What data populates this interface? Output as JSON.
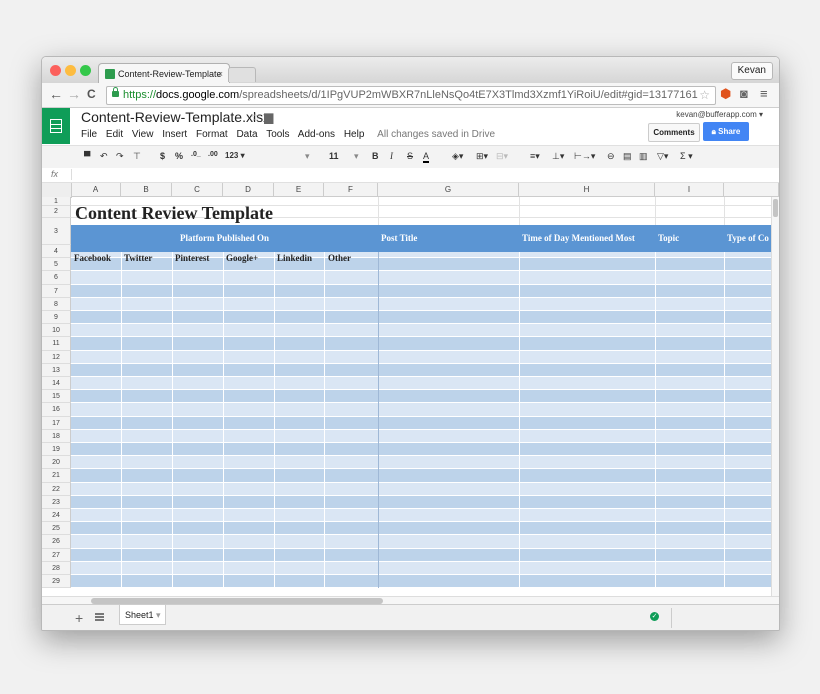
{
  "browser": {
    "tab_title": "Content-Review-Template",
    "tab_close": "×",
    "user": "Kevan",
    "url_scheme": "https://",
    "url_host": "docs.google.com",
    "url_path": "/spreadsheets/d/1IPgVUP2mWBXR7nLleNsQo4tE7X3Tlmd3Xzmf1YiRoiU/edit#gid=13177161",
    "back": "←",
    "forward": "→",
    "reload": "C"
  },
  "doc": {
    "title": "Content-Review-Template.xlsx",
    "menus": [
      "File",
      "Edit",
      "View",
      "Insert",
      "Format",
      "Data",
      "Tools",
      "Add-ons",
      "Help"
    ],
    "save_status": "All changes saved in Drive",
    "account": "kevan@bufferapp.com",
    "comments_label": "Comments",
    "share_label": "Share"
  },
  "toolbar": {
    "currency": "$",
    "percent": "%",
    "dec_decrease": ".0_",
    "dec_increase": ".00",
    "more_formats": "123",
    "font_size": "11",
    "bold": "B",
    "italic": "I",
    "strike": "S",
    "text_color": "A",
    "sum": "Σ"
  },
  "formula_bar": {
    "fx": "fx"
  },
  "columns": [
    "A",
    "B",
    "C",
    "D",
    "E",
    "F",
    "G",
    "H",
    "I",
    ""
  ],
  "rows": [
    "1",
    "2",
    "3",
    "4",
    "5",
    "6",
    "7",
    "8",
    "9",
    "10",
    "11",
    "12",
    "13",
    "14",
    "15",
    "16",
    "17",
    "18",
    "19",
    "20",
    "21",
    "22",
    "23",
    "24",
    "25",
    "26",
    "27",
    "28",
    "29"
  ],
  "sheet": {
    "title": "Content Review Template",
    "platform_header": "Platform Published On",
    "headers": [
      "Post Title",
      "Time of Day Mentioned Most",
      "Topic",
      "Type of Co"
    ],
    "platforms": [
      "Facebook",
      "Twitter",
      "Pinterest",
      "Google+",
      "Linkedin",
      "Other"
    ]
  },
  "sheet_tabs": {
    "active": "Sheet1",
    "add": "+"
  },
  "colors": {
    "header_blue": "#5b95d3",
    "row_light": "#dae6f4",
    "row_dark": "#bdd3ea",
    "accent_green": "#0f9d58",
    "share_blue": "#4285f4"
  }
}
